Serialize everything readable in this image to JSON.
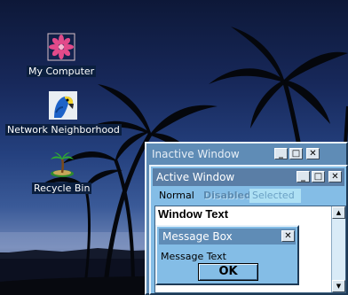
{
  "desktop": {
    "icons": [
      {
        "label": "My Computer",
        "icon": "pink-flower-icon"
      },
      {
        "label": "Network Neighborhood",
        "icon": "parrot-icon"
      },
      {
        "label": "Recycle Bin",
        "icon": "palm-tree-island-icon"
      }
    ]
  },
  "inactive_window": {
    "title": "Inactive Window",
    "buttons": {
      "minimize": "_",
      "maximize": "□",
      "close": "✕"
    }
  },
  "active_window": {
    "title": "Active Window",
    "buttons": {
      "minimize": "_",
      "maximize": "□",
      "close": "✕"
    },
    "menu": {
      "normal": "Normal",
      "disabled": "Disabled",
      "selected": "Selected"
    },
    "window_text": "Window Text",
    "scrollbar": {
      "up": "▲",
      "down": "▼"
    }
  },
  "message_box": {
    "title": "Message Box",
    "close": "✕",
    "text": "Message Text",
    "ok_label": "OK"
  },
  "colors": {
    "active_title": "#5a7ea6",
    "inactive_title": "#5f8cb6",
    "window_face": "#84bde6",
    "selected_highlight": "#aee0f4"
  }
}
